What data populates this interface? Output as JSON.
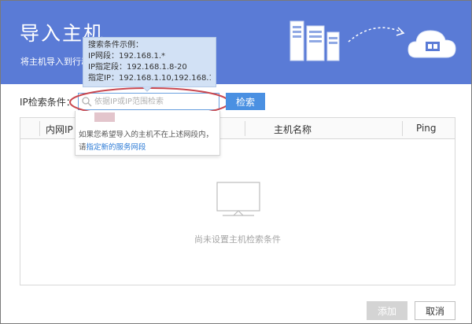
{
  "header": {
    "title": "导入主机",
    "subtitle": "将主机导入到行动"
  },
  "search": {
    "label": "IP检索条件：",
    "placeholder": "依据IP或IP范围检索",
    "button_label": "检索"
  },
  "tooltip": {
    "title": "搜索条件示例：",
    "line1": "IP网段：192.168.1.*",
    "line2": "IP指定段：192.168.1.8-20",
    "line3": "指定IP：192.168.1.10,192.168.1.23"
  },
  "hint": {
    "line1": "如果您希望导入的主机不在上述网段内，",
    "prefix": "请",
    "link": "指定新的服务网段"
  },
  "table": {
    "columns": [
      "内网IP",
      "主机名称",
      "Ping"
    ],
    "empty_text": "尚未设置主机检索条件"
  },
  "footer": {
    "add_label": "添加",
    "cancel_label": "取消"
  },
  "colors": {
    "header_bg": "#5a7bd6",
    "accent": "#4a90e2",
    "highlight_ring": "#c9474f",
    "tooltip_bg": "#d2e1f5",
    "link": "#2d7bd6",
    "disabled_button": "#d4d4d4"
  },
  "icons": {
    "header": [
      "server-icon",
      "dotted-arrow-icon",
      "cloud-icon"
    ],
    "search": "search-icon",
    "empty_state": "monitor-icon"
  }
}
